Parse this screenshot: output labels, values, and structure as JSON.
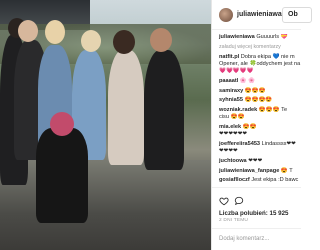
{
  "header": {
    "username": "juliawieniawa",
    "follow_label": "Ob"
  },
  "comments": [
    {
      "user": "juliawieniawa",
      "text": "Guuuurls 💝"
    },
    {
      "user": "",
      "text": "załaduj więcej komentarzy"
    },
    {
      "user": "natfit.pl",
      "text": "Dobra ekipa 💙 nie m"
    },
    {
      "user": "",
      "text": "Opener, ale 🍀oddychem jest na"
    },
    {
      "user": "",
      "text": "💗💗💗💗💗"
    },
    {
      "user": "paaaatl",
      "text": "🌸 🌸"
    },
    {
      "user": "samiraxy",
      "text": "😍😍😍"
    },
    {
      "user": "syhnia55",
      "text": "😍😍😍😍"
    },
    {
      "user": "wozniak.radek",
      "text": "😍😍😍 Te"
    },
    {
      "user": "",
      "text": "cisu 😍😍"
    },
    {
      "user": "mia.elek",
      "text": "😍😍"
    },
    {
      "user": "",
      "text": "❤❤❤❤❤❤"
    },
    {
      "user": "joeffereiira5453",
      "text": "Lindassss❤❤"
    },
    {
      "user": "",
      "text": "❤❤❤❤"
    },
    {
      "user": "juchtoowa",
      "text": "❤❤❤"
    },
    {
      "user": "juliawieniawa_fanpage",
      "text": "😍 T"
    },
    {
      "user": "gosiaflloczf",
      "text": "Jest ekipa :D bawc"
    }
  ],
  "actions": {
    "likes_label": "Liczba polubień: 15 925",
    "date_label": "2 DNI TEMU"
  },
  "add_comment": {
    "placeholder": "Dodaj komentarz..."
  },
  "colors": {
    "text": "#262626",
    "muted": "#999999"
  }
}
